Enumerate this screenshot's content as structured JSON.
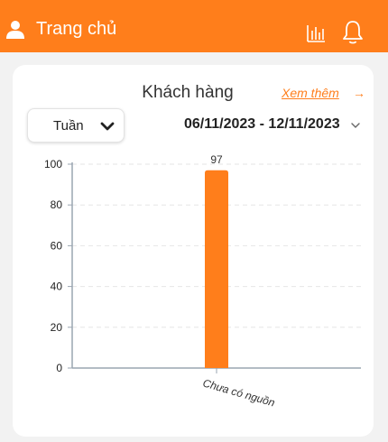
{
  "header": {
    "title": "Trang chủ",
    "icons": [
      "user-icon",
      "bar-chart-icon",
      "bell-icon"
    ],
    "color": "#ff7e1b"
  },
  "card": {
    "title": "Khách hàng",
    "see_more": "Xem thêm",
    "see_more_arrow": "→",
    "period": "Tuần",
    "date_range": "06/11/2023 - 12/11/2023"
  },
  "chart_data": {
    "type": "bar",
    "categories": [
      "Chưa có nguồn"
    ],
    "values": [
      97
    ],
    "ylim": [
      0,
      100
    ],
    "yticks": [
      0,
      20,
      40,
      60,
      80,
      100
    ],
    "grid": true,
    "bar_color": "#ff7e1b"
  }
}
